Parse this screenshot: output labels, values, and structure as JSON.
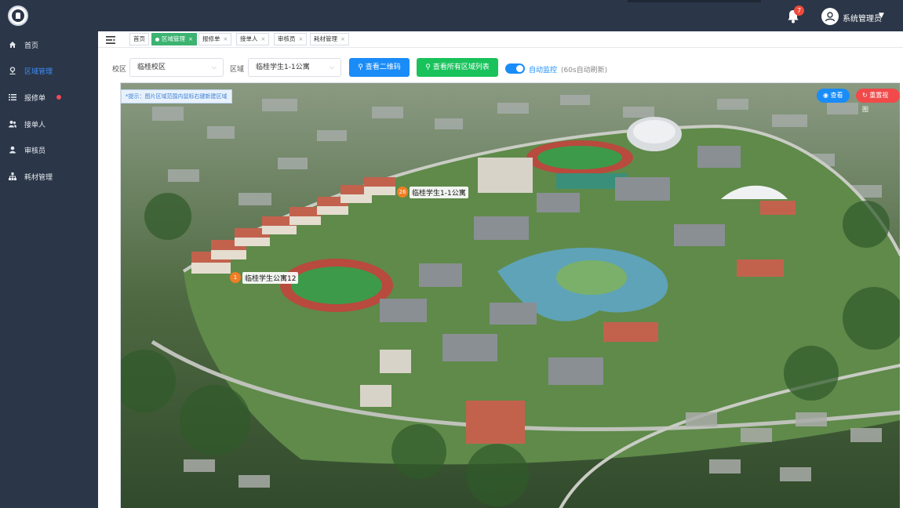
{
  "user": {
    "name": "系统管理员",
    "notifications": "7"
  },
  "sidebar": {
    "items": [
      {
        "label": "首页"
      },
      {
        "label": "区域管理"
      },
      {
        "label": "报修单"
      },
      {
        "label": "接单人"
      },
      {
        "label": "审核员"
      },
      {
        "label": "耗材管理"
      }
    ]
  },
  "tabs": [
    {
      "label": "首页"
    },
    {
      "label": "区域管理"
    },
    {
      "label": "报修单"
    },
    {
      "label": "接单人"
    },
    {
      "label": "审核员"
    },
    {
      "label": "耗材管理"
    }
  ],
  "filters": {
    "campus_label": "校区",
    "campus_value": "临桂校区",
    "area_label": "区域",
    "area_value": "临桂学生1-1公寓"
  },
  "toolbar": {
    "qr_button": "查看二维码",
    "list_button": "查看所有区域列表",
    "auto_monitor": "自动监控",
    "auto_note": "(60s自动刷新)"
  },
  "map": {
    "hint": "*提示：图片区域范围内鼠标右键新建区域",
    "view_button": "查看",
    "reset_button": "重置视图",
    "markers": [
      {
        "count": "26",
        "name": "临桂学生1-1公寓"
      },
      {
        "count": "1",
        "name": "临桂学生公寓12"
      }
    ]
  },
  "colors": {
    "sidebar_bg": "#2b3648",
    "active_blue": "#3d8ef8",
    "tab_active_green": "#3cb371",
    "button_blue": "#1a8cf8",
    "button_green": "#19c25b",
    "reset_red": "#f04a4a",
    "marker_orange": "#f07e24"
  }
}
